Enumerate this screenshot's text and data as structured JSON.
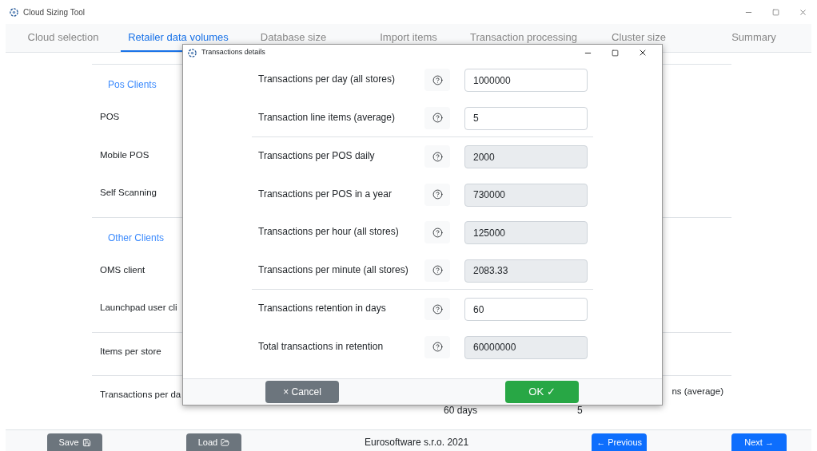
{
  "window": {
    "title": "Cloud Sizing Tool"
  },
  "tabs": [
    {
      "label": "Cloud selection",
      "selected": false
    },
    {
      "label": "Retailer data volumes",
      "selected": true
    },
    {
      "label": "Database size",
      "selected": false
    },
    {
      "label": "Import items",
      "selected": false
    },
    {
      "label": "Transaction processing",
      "selected": false
    },
    {
      "label": "Cluster size",
      "selected": false
    },
    {
      "label": "Summary",
      "selected": false
    }
  ],
  "sections": [
    {
      "heading": "Pos Clients",
      "rows": [
        "POS",
        "Mobile POS",
        "Self Scanning"
      ]
    },
    {
      "heading": "Other Clients",
      "rows": [
        "OMS client",
        "Launchpad user cli"
      ]
    },
    {
      "rows": [
        "Items per store"
      ]
    },
    {
      "rows": [
        "Transactions per da"
      ],
      "right_label": "ns (average)",
      "values": [
        "60 days",
        "5"
      ]
    }
  ],
  "dialog": {
    "title": "Transactions details",
    "groups": [
      [
        {
          "label": "Transactions per day (all stores)",
          "value": "1000000",
          "editable": true
        },
        {
          "label": "Transaction line items (average)",
          "value": "5",
          "editable": true
        }
      ],
      [
        {
          "label": "Transactions per POS daily",
          "value": "2000",
          "editable": false
        },
        {
          "label": "Transactions per POS in a year",
          "value": "730000",
          "editable": false
        },
        {
          "label": "Transactions per hour (all stores)",
          "value": "125000",
          "editable": false
        },
        {
          "label": "Transactions per minute (all stores)",
          "value": "2083.33",
          "editable": false
        }
      ],
      [
        {
          "label": "Transactions retention in days",
          "value": "60",
          "editable": true
        },
        {
          "label": "Total transactions in retention",
          "value": "60000000",
          "editable": false
        }
      ]
    ],
    "cancel": "× Cancel",
    "ok": "OK ✓"
  },
  "footer": {
    "save": "Save",
    "load": "Load",
    "copyright": "Eurosoftware s.r.o. 2021",
    "previous": "← Previous",
    "next": "Next →"
  }
}
